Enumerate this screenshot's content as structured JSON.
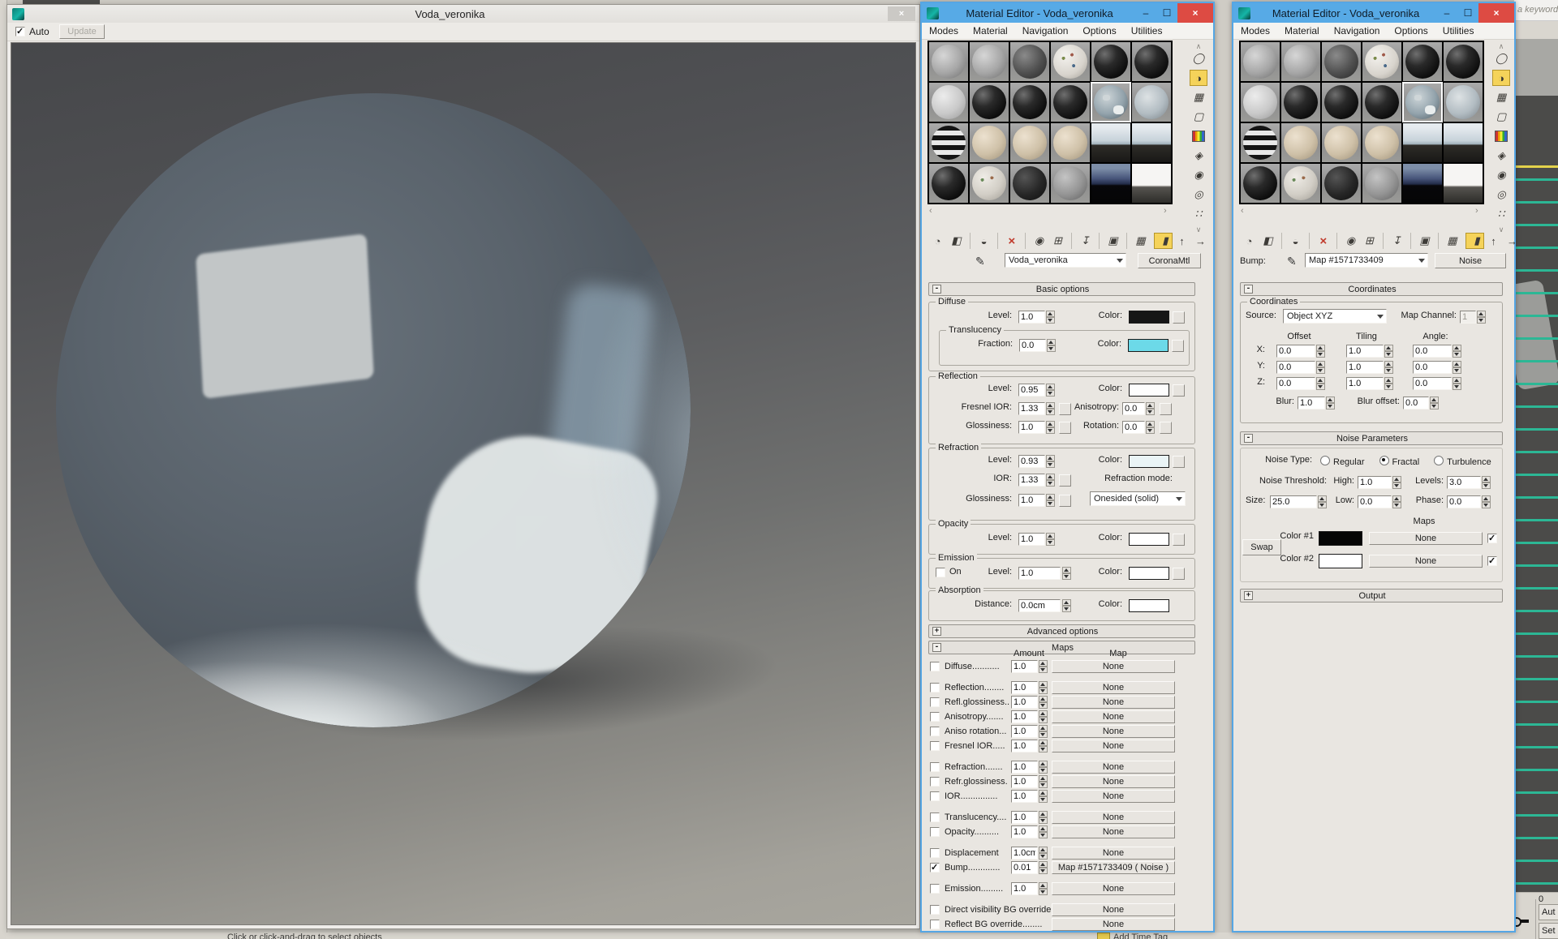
{
  "glyphs": {
    "close": "×",
    "minimize": "–",
    "maximize": "☐",
    "chevron_up": "∧",
    "chevron_down": "∨",
    "scroll_left": "‹",
    "scroll_right": "›",
    "eyedropper": "✎",
    "minus": "-",
    "plus": "+"
  },
  "menus": [
    "Modes",
    "Material",
    "Navigation",
    "Options",
    "Utilities"
  ],
  "editor_title": "Material Editor - Voda_veronika",
  "render_window": {
    "title": "Voda_veronika",
    "auto_label": "Auto",
    "update_label": "Update"
  },
  "background": {
    "keyword_hint": "a keyword",
    "status_text": "Click or click-and-drag to select objects",
    "frame_number": "0",
    "auto_key_label": "Aut",
    "set_key_label": "Set",
    "add_time_tag": "Add Time Tag"
  },
  "material_swatches": [
    {
      "style": "gray-noise"
    },
    {
      "style": "gray-noise"
    },
    {
      "style": "dark-noise"
    },
    {
      "style": "white-speckle"
    },
    {
      "style": "black-gloss"
    },
    {
      "style": "black-gloss"
    },
    {
      "style": "light-noise"
    },
    {
      "style": "black-gloss"
    },
    {
      "style": "black-gloss"
    },
    {
      "style": "black-gloss"
    },
    {
      "style": "glass",
      "selected": true
    },
    {
      "style": "glass-light"
    },
    {
      "style": "stripe"
    },
    {
      "style": "tan"
    },
    {
      "style": "tan"
    },
    {
      "style": "tan"
    },
    {
      "style": "img-light"
    },
    {
      "style": "img-light"
    },
    {
      "style": "black-gloss"
    },
    {
      "style": "speckle-map"
    },
    {
      "style": "black-rough"
    },
    {
      "style": "gray-rough"
    },
    {
      "style": "img-dark"
    },
    {
      "style": "img-white"
    }
  ],
  "side_icons": [
    {
      "name": "sample-type-sphere-icon",
      "glyph": "◯"
    },
    {
      "name": "backlight-icon",
      "glyph": "◑",
      "active": true
    },
    {
      "name": "background-checker-icon",
      "glyph": "▦"
    },
    {
      "name": "sample-uv-tiling-icon",
      "glyph": "▢"
    },
    {
      "name": "video-color-check-icon",
      "glyph": "",
      "cls": "colorbars"
    },
    {
      "name": "make-preview-icon",
      "glyph": "◈"
    },
    {
      "name": "options-icon",
      "glyph": "◉"
    },
    {
      "name": "select-by-material-icon",
      "glyph": "◎"
    },
    {
      "name": "material-map-navigator-icon",
      "glyph": "∷"
    }
  ],
  "toolbar_icons": [
    {
      "name": "get-material-icon",
      "glyph": "◔"
    },
    {
      "name": "put-material-to-scene-icon",
      "glyph": "◧"
    },
    {
      "name": "assign-material-to-selection-icon",
      "glyph": "◒",
      "sep": true
    },
    {
      "name": "reset-map-icon",
      "glyph": "×",
      "cls": "red",
      "sep": true
    },
    {
      "name": "make-material-copy-icon",
      "glyph": "◉",
      "sep": true
    },
    {
      "name": "make-unique-icon",
      "glyph": "⊞"
    },
    {
      "name": "put-to-library-icon",
      "glyph": "↧",
      "sep": true
    },
    {
      "name": "material-id-channel-icon",
      "glyph": "▣",
      "sep": true
    },
    {
      "name": "show-shaded-in-viewport-icon",
      "glyph": "▦",
      "sep": true
    },
    {
      "name": "show-end-result-icon",
      "glyph": "▮",
      "active": true,
      "sep": true
    },
    {
      "name": "go-to-parent-icon",
      "glyph": "↑"
    },
    {
      "name": "go-forward-sibling-icon",
      "glyph": "→"
    }
  ],
  "labels": {
    "level": "Level:",
    "color": "Color:",
    "fraction": "Fraction:",
    "glossiness": "Glossiness:",
    "fresnel_ior": "Fresnel IOR:",
    "anisotropy": "Anisotropy:",
    "rotation": "Rotation:",
    "ior": "IOR:",
    "distance": "Distance:",
    "on": "On"
  },
  "editor_mid": {
    "material_name": "Voda_veronika",
    "material_type": "CoronaMtl",
    "basic_header": "Basic options",
    "advanced_header": "Advanced options",
    "basic": {
      "diffuse": {
        "label": "Diffuse",
        "level": "1.0",
        "color": "#161616"
      },
      "translucency": {
        "label": "Translucency",
        "fraction": "0.0",
        "color": "#6cd9e8"
      },
      "reflection": {
        "label": "Reflection",
        "level": "0.95",
        "fresnel_ior": "1.33",
        "glossiness": "1.0",
        "anisotropy": "0.0",
        "rotation": "0.0",
        "color": "#fdfdfd"
      },
      "refraction": {
        "label": "Refraction",
        "level": "0.93",
        "ior": "1.33",
        "glossiness": "1.0",
        "mode_label": "Refraction mode:",
        "mode": "Onesided (solid)",
        "color": "#eaf4f6"
      },
      "opacity": {
        "label": "Opacity",
        "level": "1.0",
        "color": "#ffffff"
      },
      "emission": {
        "label": "Emission",
        "level": "1.0",
        "color": "#ffffff"
      },
      "absorption": {
        "label": "Absorption",
        "distance": "0.0cm",
        "color": "#ffffff"
      }
    },
    "maps": {
      "header": "Maps",
      "amount_header": "Amount",
      "map_header": "Map",
      "rows": [
        {
          "label": "Diffuse...........",
          "amount": "1.0",
          "map": "None"
        },
        {
          "label": "Reflection........",
          "amount": "1.0",
          "map": "None",
          "gap_before": true
        },
        {
          "label": "Refl.glossiness..",
          "amount": "1.0",
          "map": "None"
        },
        {
          "label": "Anisotropy.......",
          "amount": "1.0",
          "map": "None"
        },
        {
          "label": "Aniso rotation...",
          "amount": "1.0",
          "map": "None"
        },
        {
          "label": "Fresnel IOR.....",
          "amount": "1.0",
          "map": "None"
        },
        {
          "label": "Refraction.......",
          "amount": "1.0",
          "map": "None",
          "gap_before": true
        },
        {
          "label": "Refr.glossiness.",
          "amount": "1.0",
          "map": "None"
        },
        {
          "label": "IOR...............",
          "amount": "1.0",
          "map": "None"
        },
        {
          "label": "Translucency....",
          "amount": "1.0",
          "map": "None",
          "gap_before": true
        },
        {
          "label": "Opacity..........",
          "amount": "1.0",
          "map": "None"
        },
        {
          "label": "Displacement",
          "amount": "1.0cm",
          "map": "None",
          "gap_before": true
        },
        {
          "label": "Bump.............",
          "amount": "0.01",
          "map": "Map #1571733409  ( Noise )",
          "checked": true
        },
        {
          "label": "Emission.........",
          "amount": "1.0",
          "map": "None",
          "gap_before": true
        },
        {
          "label": "Direct visibility BG override",
          "map": "None",
          "gap_before": true
        },
        {
          "label": "Reflect BG override........",
          "map": "None"
        }
      ]
    }
  },
  "editor_right": {
    "bump_label": "Bump:",
    "map_name": "Map #1571733409",
    "map_type_button": "Noise",
    "coordinates": {
      "header": "Coordinates",
      "group": "Coordinates",
      "source_label": "Source:",
      "source": "Object XYZ",
      "map_channel_label": "Map Channel:",
      "map_channel": "1",
      "offset_header": "Offset",
      "tiling_header": "Tiling",
      "angle_header": "Angle:",
      "rows": [
        {
          "axis": "X:",
          "offset": "0.0",
          "tiling": "1.0",
          "angle": "0.0"
        },
        {
          "axis": "Y:",
          "offset": "0.0",
          "tiling": "1.0",
          "angle": "0.0"
        },
        {
          "axis": "Z:",
          "offset": "0.0",
          "tiling": "1.0",
          "angle": "0.0"
        }
      ],
      "blur_label": "Blur:",
      "blur": "1.0",
      "blur_offset_label": "Blur offset:",
      "blur_offset": "0.0"
    },
    "noise": {
      "header": "Noise Parameters",
      "type_label": "Noise Type:",
      "types": [
        {
          "label": "Regular"
        },
        {
          "label": "Fractal",
          "selected": true
        },
        {
          "label": "Turbulence"
        }
      ],
      "threshold_label": "Noise Threshold:",
      "high_label": "High:",
      "high": "1.0",
      "levels_label": "Levels:",
      "levels": "3.0",
      "size_label": "Size:",
      "size": "25.0",
      "low_label": "Low:",
      "low": "0.0",
      "phase_label": "Phase:",
      "phase": "0.0",
      "maps_label": "Maps",
      "swap_label": "Swap",
      "color1_label": "Color #1",
      "color1": "#050505",
      "map1": "None",
      "color2_label": "Color #2",
      "color2": "#ffffff",
      "map2": "None"
    },
    "output_header": "Output"
  }
}
